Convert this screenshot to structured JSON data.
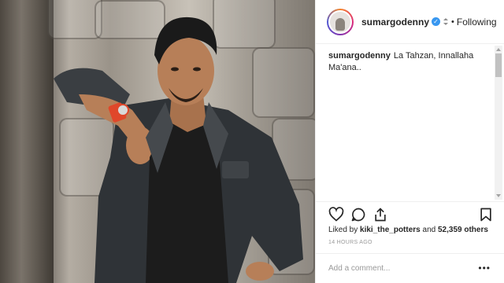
{
  "post": {
    "image_alt": "",
    "author": {
      "username": "sumargodenny",
      "verified_icon": "verified-badge-icon",
      "dot": "•",
      "follow_status": "Following"
    },
    "caption": {
      "username": "sumargodenny",
      "text": "La Tahzan, Innallaha Ma'ana.."
    },
    "actions": {
      "like_icon": "heart-icon",
      "comment_icon": "comment-bubble-icon",
      "share_icon": "share-icon",
      "save_icon": "bookmark-icon"
    },
    "likes": {
      "prefix": "Liked by",
      "user": "kiki_the_potters",
      "and": "and",
      "others": "52,359 others"
    },
    "timestamp": "14 HOURS AGO",
    "comment": {
      "placeholder": "Add a comment...",
      "more_icon": "more-options-icon"
    },
    "colors": {
      "verified": "#3897f0",
      "watch_strap": "#e0472a",
      "text": "#262626",
      "muted": "#999999"
    }
  }
}
